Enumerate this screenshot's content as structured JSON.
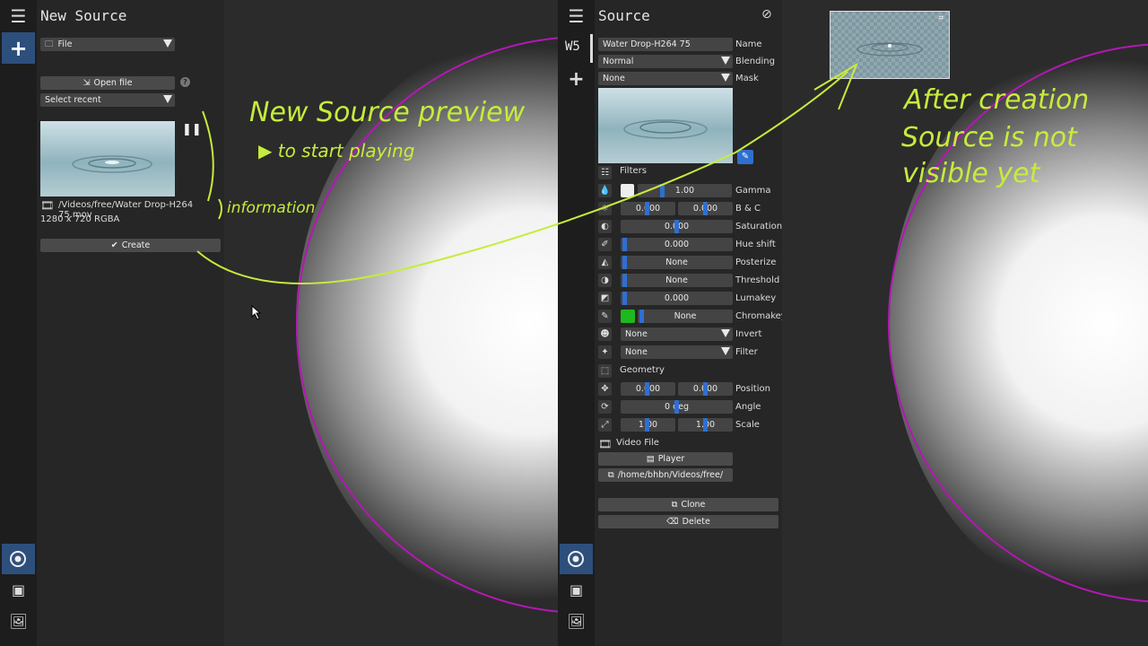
{
  "left": {
    "title": "New Source",
    "type_select": "File",
    "open_file": "Open file",
    "help": "?",
    "select_recent": "Select recent",
    "file_path": "/Videos/free/Water Drop-H264 75.mov",
    "file_info": "1280 x 720 RGBA",
    "create": "Create"
  },
  "right": {
    "title": "Source",
    "workspace": "W5",
    "name_value": "Water Drop-H264 75",
    "name_label": "Name",
    "blending_value": "Normal",
    "blending_label": "Blending",
    "mask_value": "None",
    "mask_label": "Mask",
    "filters_title": "Filters",
    "filters": [
      {
        "values": [
          "1.00"
        ],
        "label": "Gamma"
      },
      {
        "values": [
          "0.000",
          "0.000"
        ],
        "label": "B & C"
      },
      {
        "values": [
          "0.000"
        ],
        "label": "Saturation"
      },
      {
        "values": [
          "0.000"
        ],
        "label": "Hue shift"
      },
      {
        "values": [
          "None"
        ],
        "label": "Posterize"
      },
      {
        "values": [
          "None"
        ],
        "label": "Threshold"
      },
      {
        "values": [
          "0.000"
        ],
        "label": "Lumakey"
      },
      {
        "values": [
          "None"
        ],
        "label": "Chromakey"
      },
      {
        "values": [
          "None"
        ],
        "label": "Invert"
      },
      {
        "values": [
          "None"
        ],
        "label": "Filter"
      }
    ],
    "geometry_title": "Geometry",
    "geometry": [
      {
        "values": [
          "0.000",
          "0.000"
        ],
        "label": "Position"
      },
      {
        "values": [
          "0 deg"
        ],
        "label": "Angle"
      },
      {
        "values": [
          "1.00",
          "1.00"
        ],
        "label": "Scale"
      }
    ],
    "video_title": "Video File",
    "player": "Player",
    "path": "/home/bhbn/Videos/free/",
    "clone": "Clone",
    "delete": "Delete"
  },
  "annotations": {
    "preview_title": "New Source preview",
    "preview_sub": "▶ to start playing",
    "information": "information",
    "after_1": "After creation",
    "after_2": "Source is not",
    "after_3": "visible yet"
  },
  "colors": {
    "accent_blue": "#2f6fd0",
    "ring": "#b318b3",
    "annotation": "#c6ec3c",
    "chroma_green": "#1fb81f"
  }
}
